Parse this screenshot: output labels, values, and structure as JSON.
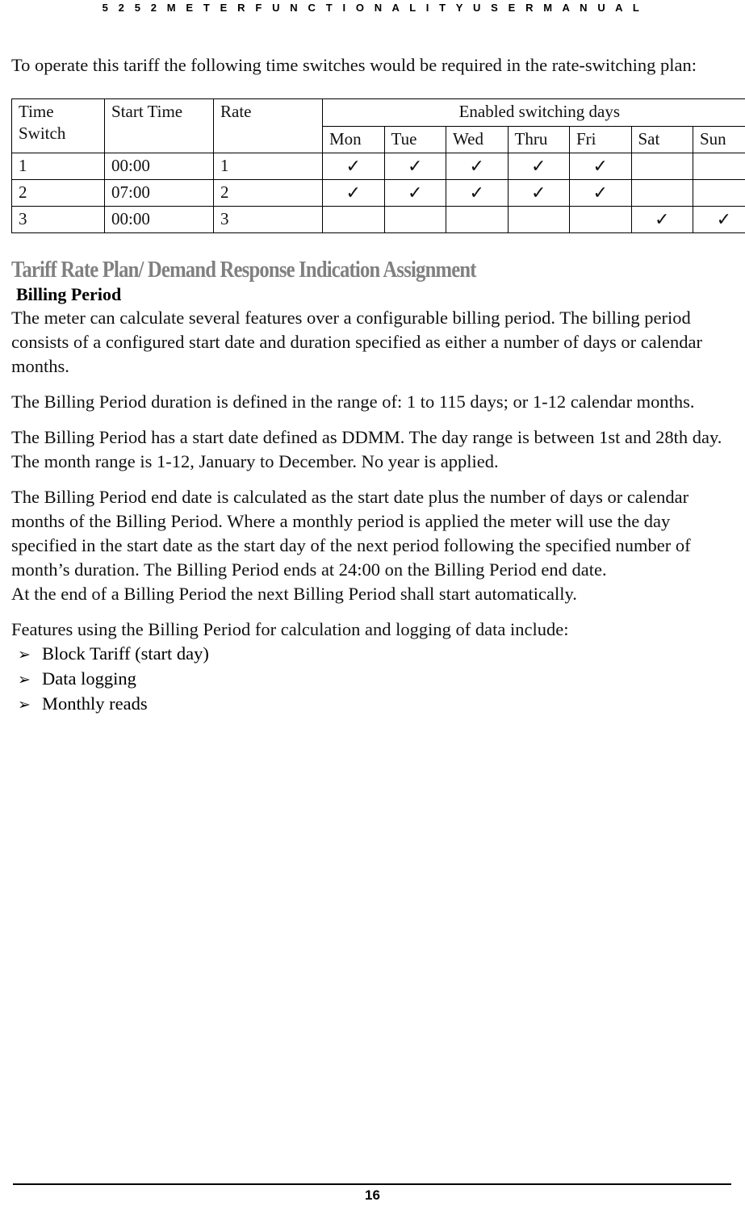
{
  "running_header": "5 2 5 2   M E T E R   F U N C T I O N A L I T Y   U S E R   M A N U A L",
  "intro": {
    "paragraph": "To operate this tariff the following time switches would be required in the rate-switching plan:"
  },
  "table": {
    "headers": {
      "time_switch": "Time Switch",
      "time_switch_line1": "Time",
      "time_switch_line2": "Switch",
      "start_time": "Start Time",
      "rate": "Rate",
      "group": "Enabled switching days",
      "days": [
        "Mon",
        "Tue",
        "Wed",
        "Thru",
        "Fri",
        "Sat",
        "Sun"
      ]
    },
    "tick_glyph": "✓",
    "rows": [
      {
        "switch": "1",
        "start_time": "00:00",
        "rate": "1",
        "days": [
          true,
          true,
          true,
          true,
          true,
          false,
          false
        ]
      },
      {
        "switch": "2",
        "start_time": "07:00",
        "rate": "2",
        "days": [
          true,
          true,
          true,
          true,
          true,
          false,
          false
        ]
      },
      {
        "switch": "3",
        "start_time": "00:00",
        "rate": "3",
        "days": [
          false,
          false,
          false,
          false,
          false,
          true,
          true
        ]
      }
    ]
  },
  "section": {
    "heading": "Tariff Rate Plan/ Demand Response Indication Assignment",
    "heading_color": "#808080",
    "sub_heading": "Billing Period",
    "paragraphs": [
      "The meter can calculate several features over a configurable billing period. The billing period consists of a configured start date and duration specified as either a number of days or calendar months.",
      "The Billing Period duration is defined in the range of: 1 to 115 days; or 1-12 calendar months.",
      "The Billing Period has a start date defined as DDMM. The day range is between 1st and 28th day. The month range is 1-12, January to December. No year is applied.",
      "The Billing Period end date is calculated as the start date plus the number of days or calendar months of the Billing Period. Where a monthly period is applied the meter will use the day specified in the start date as the start day of the next period following the specified number of month’s duration. The Billing Period ends at 24:00 on the Billing Period end date.",
      "At the end of a Billing Period the next Billing Period shall start automatically."
    ],
    "features_intro": "Features using the Billing Period for calculation and logging of data include:",
    "bullet_glyph": "➢",
    "features": [
      "Block Tariff (start day)",
      "Data logging",
      "Monthly reads"
    ]
  },
  "footer": {
    "page_number": "16"
  }
}
